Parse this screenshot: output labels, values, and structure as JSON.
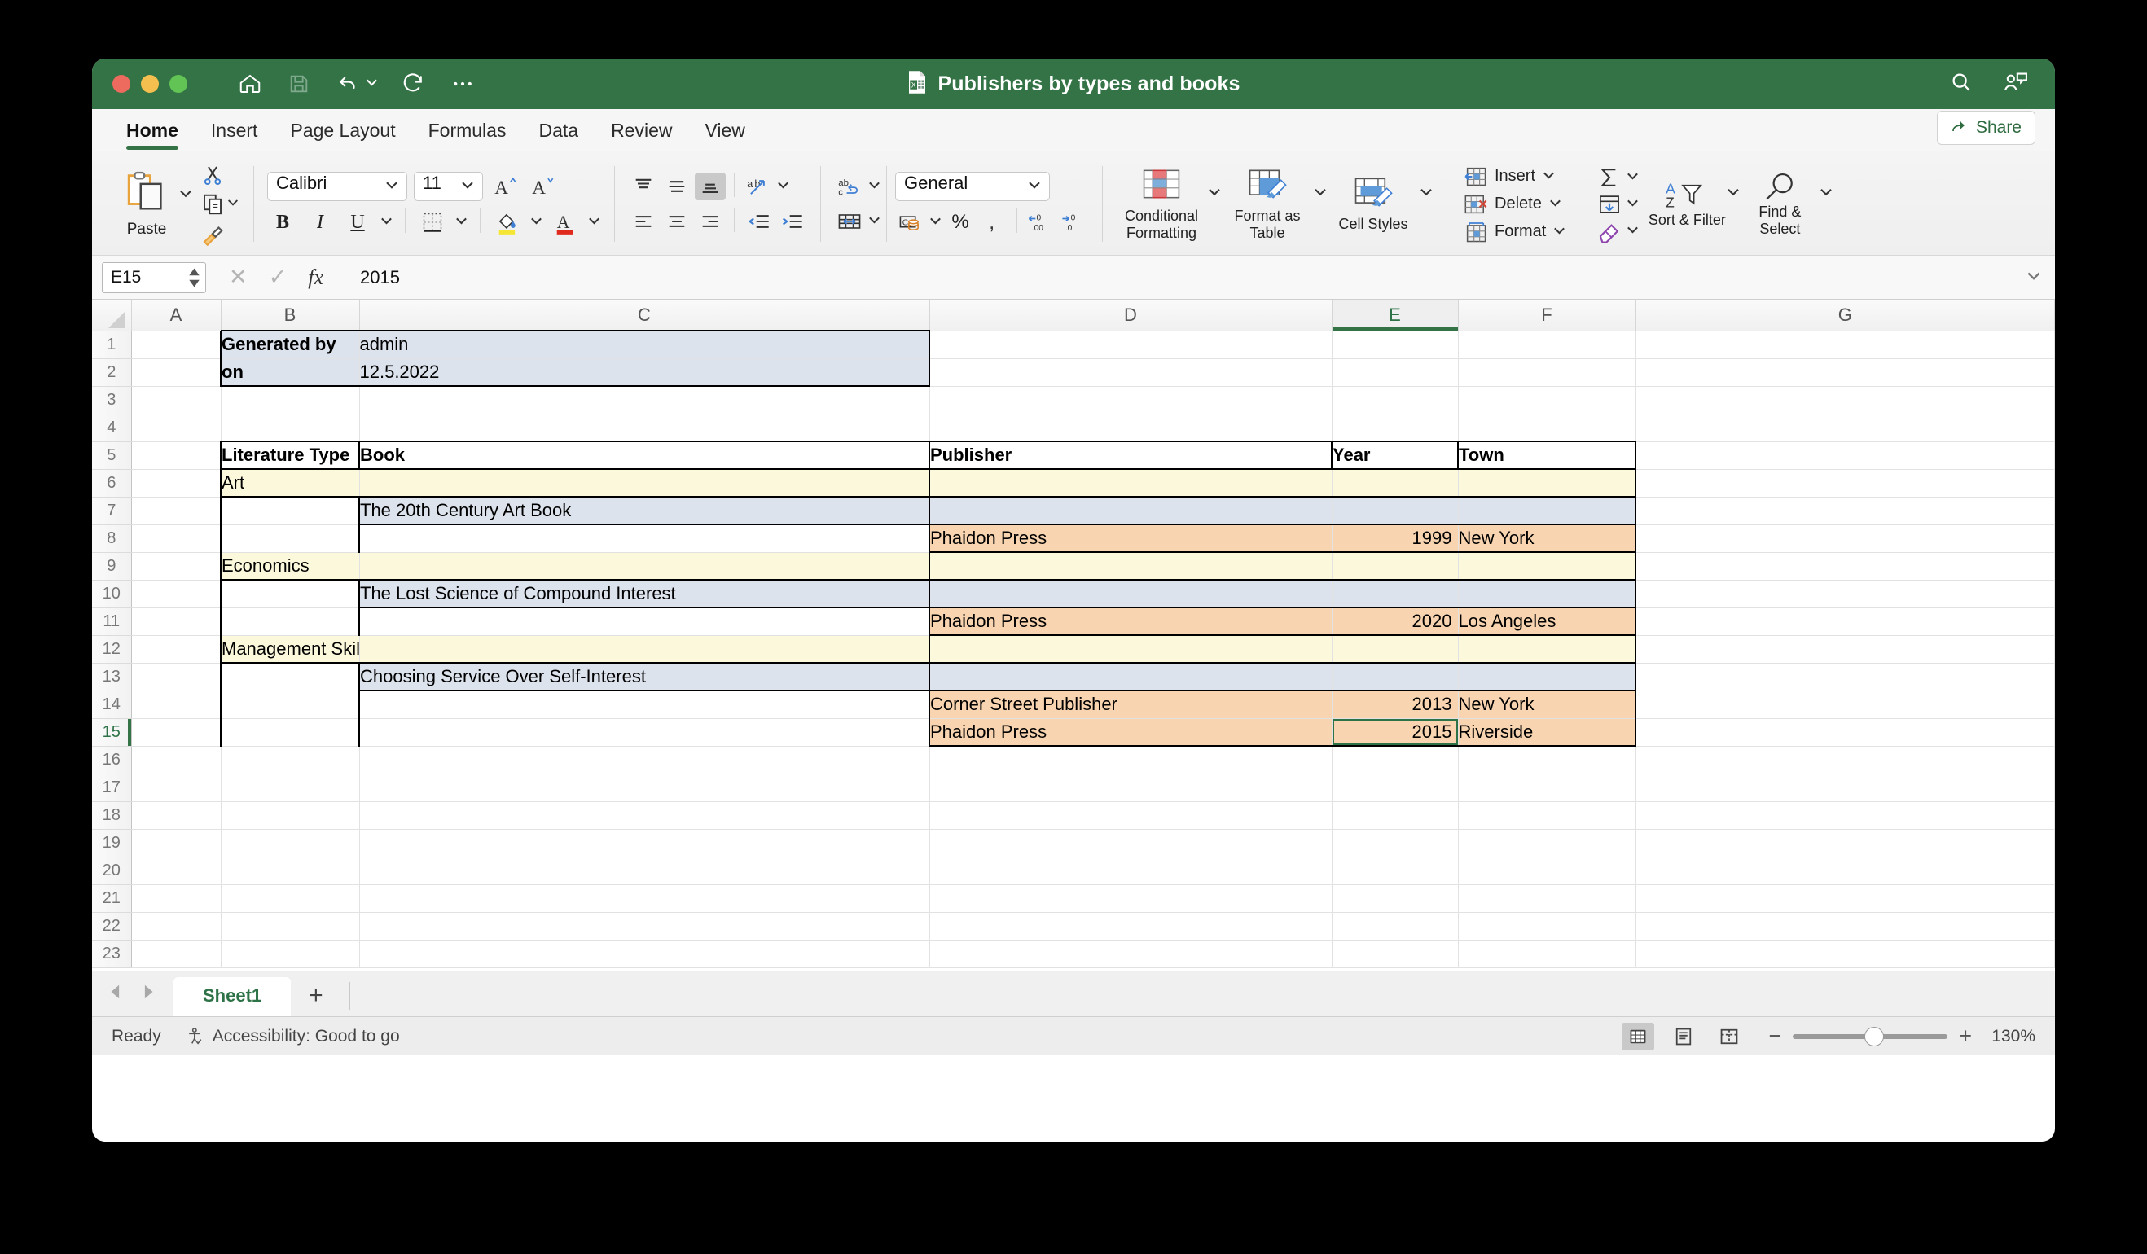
{
  "window": {
    "title": "Publishers by types and books",
    "app_icon": "excel-file-icon"
  },
  "quick_access": {
    "home": "home-icon",
    "save": "save-icon",
    "undo": "undo-icon",
    "redo": "redo-icon",
    "more": "more-options-icon"
  },
  "title_right": {
    "search": "search-icon",
    "comments": "comments-icon"
  },
  "ribbon_tabs": [
    {
      "label": "Home",
      "active": true
    },
    {
      "label": "Insert",
      "active": false
    },
    {
      "label": "Page Layout",
      "active": false
    },
    {
      "label": "Formulas",
      "active": false
    },
    {
      "label": "Data",
      "active": false
    },
    {
      "label": "Review",
      "active": false
    },
    {
      "label": "View",
      "active": false
    }
  ],
  "share": {
    "label": "Share"
  },
  "ribbon": {
    "clipboard": {
      "paste_label": "Paste",
      "cut": "cut-icon",
      "copy": "copy-icon",
      "format_painter": "format-painter-icon"
    },
    "font": {
      "family": "Calibri",
      "size": "11",
      "grow": "increase-font-size-icon",
      "shrink": "decrease-font-size-icon",
      "bold": "B",
      "italic": "I",
      "underline": "U",
      "borders": "borders-icon",
      "fill_color": "fill-color-icon",
      "font_color": "font-color-icon"
    },
    "alignment": {
      "top": "align-top-icon",
      "middle": "align-middle-icon",
      "bottom": "align-bottom-icon",
      "left": "align-left-icon",
      "center": "align-center-icon",
      "right": "align-right-icon",
      "wrap_text": "wrap-text-icon",
      "decrease_indent": "decrease-indent-icon",
      "increase_indent": "increase-indent-icon",
      "orientation": "orientation-icon",
      "merge": "merge-cells-icon"
    },
    "number": {
      "format": "General",
      "accounting": "accounting-format-icon",
      "percent": "%",
      "comma": "comma-style-icon",
      "increase_decimal": "increase-decimal-icon",
      "decrease_decimal": "decrease-decimal-icon"
    },
    "styles": {
      "conditional_formatting": "Conditional Formatting",
      "format_as_table": "Format as Table",
      "cell_styles": "Cell Styles"
    },
    "cells": {
      "insert": "Insert",
      "delete": "Delete",
      "format": "Format"
    },
    "editing": {
      "autosum": "autosum-icon",
      "fill": "fill-down-icon",
      "clear": "clear-icon",
      "sort_filter": "Sort & Filter",
      "find_select": "Find & Select"
    }
  },
  "formula_bar": {
    "name_box": "E15",
    "cancel": "cancel-icon",
    "enter": "enter-icon",
    "fx": "fx",
    "value": "2015",
    "expand": "expand-formula-bar-icon"
  },
  "grid": {
    "columns": [
      "A",
      "B",
      "C",
      "D",
      "E",
      "F",
      "G"
    ],
    "selected_column": "E",
    "selected_row": 15,
    "selected_cell": "E15",
    "rows": [
      {
        "n": 1,
        "cells": {
          "B": "Generated by",
          "C": "admin"
        }
      },
      {
        "n": 2,
        "cells": {
          "B": "on",
          "C": "12.5.2022"
        }
      },
      {
        "n": 3,
        "cells": {}
      },
      {
        "n": 4,
        "cells": {}
      },
      {
        "n": 5,
        "cells": {
          "B": "Literature Type",
          "C": "Book",
          "D": "Publisher",
          "E": "Year",
          "F": "Town"
        }
      },
      {
        "n": 6,
        "cells": {
          "B": "Art"
        }
      },
      {
        "n": 7,
        "cells": {
          "C": "The 20th Century Art Book"
        }
      },
      {
        "n": 8,
        "cells": {
          "D": "Phaidon Press",
          "E": "1999",
          "F": "New York"
        }
      },
      {
        "n": 9,
        "cells": {
          "B": "Economics"
        }
      },
      {
        "n": 10,
        "cells": {
          "C": "The Lost Science of Compound Interest"
        }
      },
      {
        "n": 11,
        "cells": {
          "D": "Phaidon Press",
          "E": "2020",
          "F": "Los Angeles"
        }
      },
      {
        "n": 12,
        "cells": {
          "B": "Management Skills"
        }
      },
      {
        "n": 13,
        "cells": {
          "C": "Choosing Service Over Self-Interest"
        }
      },
      {
        "n": 14,
        "cells": {
          "D": "Corner Street Publisher",
          "E": "2013",
          "F": "New York"
        }
      },
      {
        "n": 15,
        "cells": {
          "D": "Phaidon Press",
          "E": "2015",
          "F": "Riverside"
        }
      },
      {
        "n": 16,
        "cells": {}
      },
      {
        "n": 17,
        "cells": {}
      },
      {
        "n": 18,
        "cells": {}
      },
      {
        "n": 19,
        "cells": {}
      },
      {
        "n": 20,
        "cells": {}
      },
      {
        "n": 21,
        "cells": {}
      },
      {
        "n": 22,
        "cells": {}
      },
      {
        "n": 23,
        "cells": {}
      }
    ]
  },
  "sheet_tabs": {
    "prev": "previous-sheet-icon",
    "next": "next-sheet-icon",
    "tabs": [
      {
        "label": "Sheet1",
        "active": true
      }
    ],
    "add": "+"
  },
  "status_bar": {
    "status": "Ready",
    "accessibility": "Accessibility: Good to go",
    "views": [
      "normal-view-icon",
      "page-layout-view-icon",
      "page-break-view-icon"
    ],
    "zoom_out": "−",
    "zoom_in": "+",
    "zoom_level": "130%"
  },
  "colors": {
    "excel_green": "#347346",
    "header_blue": "#DCE3EC",
    "type_yellow": "#FCF8DC",
    "publisher_peach": "#F8D5B0",
    "selection_green": "#2E7347"
  }
}
